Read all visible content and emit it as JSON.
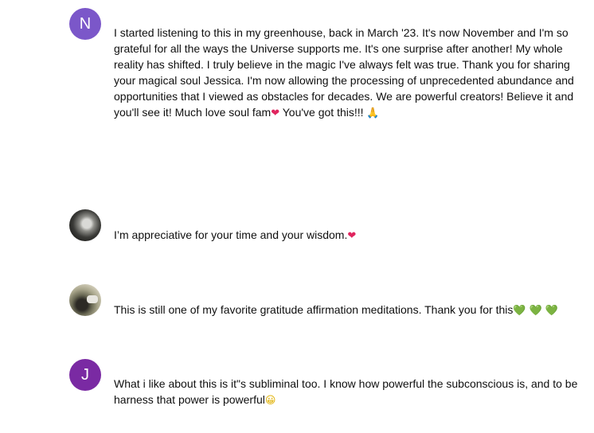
{
  "comments": [
    {
      "avatar_letter": "N",
      "avatar_color": "#7b57c9",
      "lines": [
        "I started listening to this in my greenhouse, back in March '23. It's now November and I'm so",
        "grateful for all the ways the Universe supports me. It's one  surprise after another! My whole",
        "reality has shifted. I truly believe in the magic I've always felt was true. Thank you for sharing",
        "your magical soul Jessica. I'm now allowing the processing of unprecedented abundance and",
        "opportunities that I viewed as obstacles for decades. We are powerful creators! Believe it and",
        "you'll see it! Much love soul fam"
      ],
      "tail_text": " You've got this!!! ",
      "emoji_1": "❤",
      "emoji_2": "🙏"
    },
    {
      "avatar_icon": "profile-photo",
      "text": "I’m appreciative for your time and your wisdom.",
      "emoji": "❤"
    },
    {
      "avatar_icon": "profile-photo",
      "text": "This is still one of my favorite gratitude affirmation meditations. Thank you for this",
      "emojis": [
        "💚",
        "💚",
        "💚"
      ]
    },
    {
      "avatar_letter": "J",
      "avatar_color": "#7a2aa3",
      "lines": [
        "What i like about this is it\"s subliminal too. I know how powerful the subconscious is, and to be",
        "harness that power is powerful"
      ],
      "emoji": "😀"
    }
  ]
}
